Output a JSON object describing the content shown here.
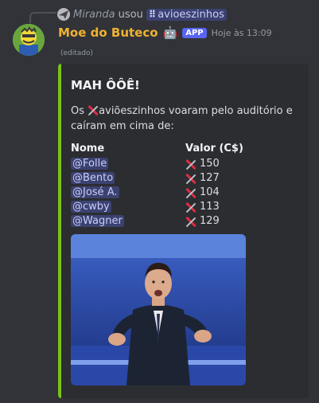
{
  "reply": {
    "user": "Miranda",
    "used_text": "usou",
    "command": "avioeszinhos"
  },
  "message": {
    "author": "Moe do Buteco",
    "author_color": "#f0b232",
    "bot_emoji": "🤖",
    "badge": "APP",
    "timestamp": "Hoje às 13:09",
    "edited": "(editado)"
  },
  "embed": {
    "accent_color": "#79c314",
    "title": "MAH ÔÔÊ!",
    "description_before": "Os",
    "description_after": "aviõeszinhos voaram pelo auditório e caíram em cima de:",
    "fields": {
      "names_header": "Nome",
      "values_header": "Valor (C$)",
      "rows": [
        {
          "name": "@Folle",
          "value": "150"
        },
        {
          "name": "@Bento",
          "value": "127"
        },
        {
          "name": "@José A.",
          "value": "104"
        },
        {
          "name": "@cwby",
          "value": "113"
        },
        {
          "name": "@Wagner",
          "value": "129"
        }
      ]
    }
  },
  "icons": {
    "plane": "paper-plane-icon",
    "command": "slash-command-icon"
  }
}
